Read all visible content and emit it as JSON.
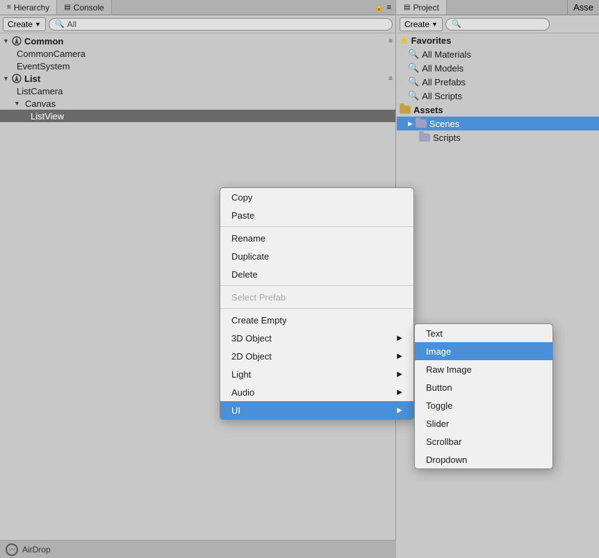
{
  "hierarchy": {
    "tabs": [
      {
        "label": "Hierarchy",
        "icon": "≡",
        "active": true
      },
      {
        "label": "Console",
        "icon": "▤",
        "active": false
      }
    ],
    "toolbar": {
      "create_label": "Create",
      "search_placeholder": "All",
      "search_value": "All"
    },
    "tree": [
      {
        "id": "common",
        "label": "Common",
        "level": 0,
        "has_arrow": true,
        "arrow_open": true,
        "has_unity_icon": true,
        "selected": false,
        "has_menu": true
      },
      {
        "id": "common-camera",
        "label": "CommonCamera",
        "level": 1,
        "has_arrow": false,
        "selected": false
      },
      {
        "id": "event-system",
        "label": "EventSystem",
        "level": 1,
        "has_arrow": false,
        "selected": false
      },
      {
        "id": "list",
        "label": "List",
        "level": 0,
        "has_arrow": true,
        "arrow_open": true,
        "has_unity_icon": true,
        "selected": false,
        "has_menu": true
      },
      {
        "id": "list-camera",
        "label": "ListCamera",
        "level": 1,
        "has_arrow": false,
        "selected": false
      },
      {
        "id": "canvas",
        "label": "Canvas",
        "level": 1,
        "has_arrow": true,
        "arrow_open": true,
        "selected": false
      },
      {
        "id": "list-view",
        "label": "ListView",
        "level": 2,
        "has_arrow": false,
        "selected": true
      }
    ],
    "bottom": {
      "label": "AirDrop"
    }
  },
  "project": {
    "tab_label": "Project",
    "tab_icon": "▤",
    "assets_label": "Asse",
    "toolbar": {
      "create_label": "Create"
    },
    "favorites": {
      "label": "Favorites",
      "items": [
        {
          "label": "All Materials"
        },
        {
          "label": "All Models"
        },
        {
          "label": "All Prefabs"
        },
        {
          "label": "All Scripts"
        }
      ]
    },
    "assets": {
      "label": "Assets",
      "items": [
        {
          "label": "Scenes",
          "open": true
        },
        {
          "label": "Scripts"
        }
      ]
    }
  },
  "context_menu": {
    "items": [
      {
        "label": "Copy",
        "disabled": false,
        "has_arrow": false
      },
      {
        "label": "Paste",
        "disabled": false,
        "has_arrow": false
      },
      {
        "separator_after": true
      },
      {
        "label": "Rename",
        "disabled": false,
        "has_arrow": false
      },
      {
        "label": "Duplicate",
        "disabled": false,
        "has_arrow": false
      },
      {
        "label": "Delete",
        "disabled": false,
        "has_arrow": false
      },
      {
        "separator_after": true
      },
      {
        "label": "Select Prefab",
        "disabled": true,
        "has_arrow": false
      },
      {
        "separator_after": true
      },
      {
        "label": "Create Empty",
        "disabled": false,
        "has_arrow": false
      },
      {
        "label": "3D Object",
        "disabled": false,
        "has_arrow": true
      },
      {
        "label": "2D Object",
        "disabled": false,
        "has_arrow": true
      },
      {
        "label": "Light",
        "disabled": false,
        "has_arrow": true
      },
      {
        "label": "Audio",
        "disabled": false,
        "has_arrow": true
      },
      {
        "label": "UI",
        "disabled": false,
        "has_arrow": true,
        "highlighted": true
      }
    ]
  },
  "sub_menu": {
    "items": [
      {
        "label": "Text",
        "highlighted": false
      },
      {
        "label": "Image",
        "highlighted": true
      },
      {
        "label": "Raw Image",
        "highlighted": false
      },
      {
        "label": "Button",
        "highlighted": false
      },
      {
        "label": "Toggle",
        "highlighted": false
      },
      {
        "label": "Slider",
        "highlighted": false
      },
      {
        "label": "Scrollbar",
        "highlighted": false
      },
      {
        "label": "Dropdown",
        "highlighted": false
      }
    ]
  },
  "icons": {
    "triangle_right": "▶",
    "triangle_down": "▼",
    "arrow_right": "▶",
    "lock": "🔒",
    "menu_lines": "≡",
    "star": "★",
    "lens": "🔍"
  }
}
